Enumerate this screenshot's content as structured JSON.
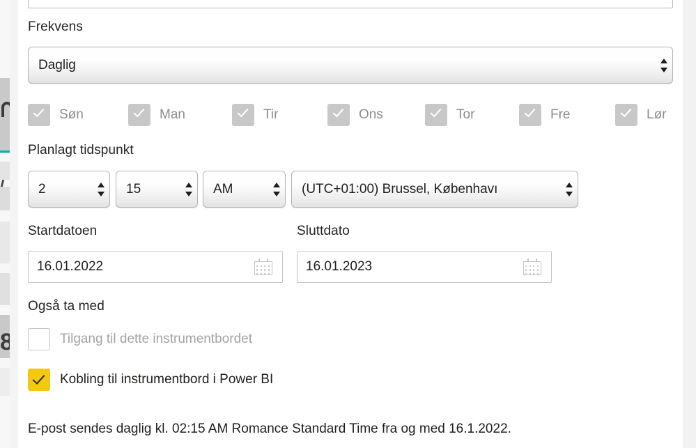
{
  "dialog": {
    "frequency": {
      "label": "Frekvens",
      "value": "Daglig"
    },
    "days": [
      {
        "label": "Søn",
        "checked": true,
        "disabled": true
      },
      {
        "label": "Man",
        "checked": true,
        "disabled": true
      },
      {
        "label": "Tir",
        "checked": true,
        "disabled": true
      },
      {
        "label": "Ons",
        "checked": true,
        "disabled": true
      },
      {
        "label": "Tor",
        "checked": true,
        "disabled": true
      },
      {
        "label": "Fre",
        "checked": true,
        "disabled": true
      },
      {
        "label": "Lør",
        "checked": true,
        "disabled": true
      }
    ],
    "scheduled_time": {
      "label": "Planlagt tidspunkt",
      "hour": "2",
      "minute": "15",
      "meridiem": "AM",
      "timezone": "(UTC+01:00) Brussel, Københavı"
    },
    "start_date": {
      "label": "Startdatoen",
      "value": "16.01.2022",
      "icon": "calendar-icon"
    },
    "end_date": {
      "label": "Sluttdato",
      "value": "16.01.2023",
      "icon": "calendar-icon"
    },
    "also_include": {
      "label": "Også ta med",
      "options": [
        {
          "label": "Tilgang til dette instrumentbordet",
          "checked": false,
          "disabled": true
        },
        {
          "label": "Kobling til instrumentbord i Power BI",
          "checked": true,
          "disabled": false
        }
      ]
    },
    "summary": "E-post sendes daglig kl. 02:15 AM Romance Standard Time fra og med 16.1.2022."
  },
  "background": {
    "partial_glyph": "8"
  },
  "colors": {
    "accent_yellow": "#f2c811",
    "accent_teal": "#00b6b0",
    "panel_bg": "#ffffff",
    "page_bg": "#f2f2f2",
    "text": "#201f1e",
    "muted_text": "#8d8d8d",
    "disabled_box": "#c8c8c8",
    "border": "#c8c6c4"
  }
}
